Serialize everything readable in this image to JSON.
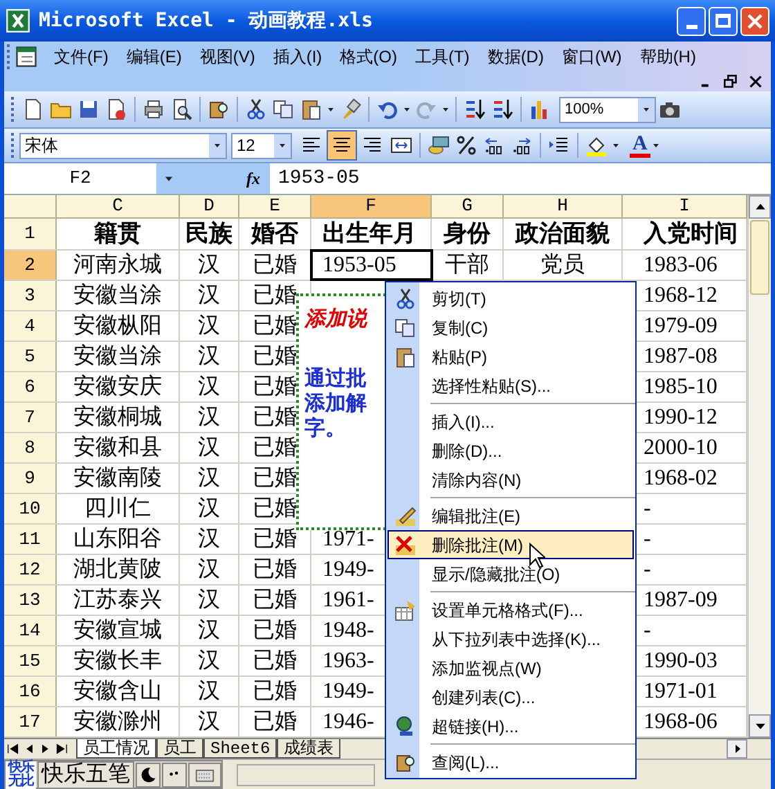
{
  "window": {
    "title": "Microsoft Excel - 动画教程.xls"
  },
  "menu_bar": [
    {
      "label": "文件(F)"
    },
    {
      "label": "编辑(E)"
    },
    {
      "label": "视图(V)"
    },
    {
      "label": "插入(I)"
    },
    {
      "label": "格式(O)"
    },
    {
      "label": "工具(T)"
    },
    {
      "label": "数据(D)"
    },
    {
      "label": "窗口(W)"
    },
    {
      "label": "帮助(H)"
    }
  ],
  "standard_toolbar": {
    "zoom": "100%"
  },
  "formatting_toolbar": {
    "font": "宋体",
    "size": "12",
    "align": [
      {
        "kind": "left",
        "selected": false
      },
      {
        "kind": "center",
        "selected": true
      },
      {
        "kind": "right",
        "selected": false
      }
    ],
    "font_color_label": "A"
  },
  "formula_bar": {
    "name_box": "F2",
    "function_label": "fx",
    "formula": "1953-05"
  },
  "sheet": {
    "columns": [
      {
        "label": "C",
        "selected": false
      },
      {
        "label": "D",
        "selected": false
      },
      {
        "label": "E",
        "selected": false
      },
      {
        "label": "F",
        "selected": true
      },
      {
        "label": "G",
        "selected": false
      },
      {
        "label": "H",
        "selected": false
      },
      {
        "label": "I",
        "selected": false
      }
    ],
    "rows": [
      {
        "header": "1",
        "selected": false,
        "cells": [
          "籍贯",
          "民族",
          "婚否",
          "出生年月",
          "身份",
          "政治面貌",
          "入党时间"
        ]
      },
      {
        "header": "2",
        "selected": true,
        "cells": [
          "河南永城",
          "汉",
          "已婚",
          "1953-05",
          "干部",
          "党员",
          "1983-06"
        ]
      },
      {
        "header": "3",
        "selected": false,
        "cells": [
          "安徽当涂",
          "汉",
          "已婚",
          null,
          null,
          null,
          "1968-12"
        ]
      },
      {
        "header": "4",
        "selected": false,
        "cells": [
          "安徽枞阳",
          "汉",
          "已婚",
          null,
          null,
          null,
          "1979-09"
        ]
      },
      {
        "header": "5",
        "selected": false,
        "cells": [
          "安徽当涂",
          "汉",
          "已婚",
          null,
          null,
          null,
          "1987-08"
        ]
      },
      {
        "header": "6",
        "selected": false,
        "cells": [
          "安徽安庆",
          "汉",
          "已婚",
          null,
          null,
          null,
          "1985-10"
        ]
      },
      {
        "header": "7",
        "selected": false,
        "cells": [
          "安徽桐城",
          "汉",
          "已婚",
          null,
          null,
          null,
          "1990-12"
        ]
      },
      {
        "header": "8",
        "selected": false,
        "cells": [
          "安徽和县",
          "汉",
          "已婚",
          null,
          null,
          null,
          "2000-10"
        ]
      },
      {
        "header": "9",
        "selected": false,
        "cells": [
          "安徽南陵",
          "汉",
          "已婚",
          null,
          null,
          null,
          "1968-02"
        ]
      },
      {
        "header": "10",
        "selected": false,
        "cells": [
          "四川仁",
          "汉",
          "已婚",
          null,
          null,
          null,
          "-"
        ]
      },
      {
        "header": "11",
        "selected": false,
        "cells": [
          "山东阳谷",
          "汉",
          "已婚",
          "1971-",
          null,
          null,
          "-"
        ]
      },
      {
        "header": "12",
        "selected": false,
        "cells": [
          "湖北黄陂",
          "汉",
          "已婚",
          "1949-",
          null,
          null,
          "-"
        ]
      },
      {
        "header": "13",
        "selected": false,
        "cells": [
          "江苏泰兴",
          "汉",
          "已婚",
          "1961-",
          null,
          null,
          "1987-09"
        ]
      },
      {
        "header": "14",
        "selected": false,
        "cells": [
          "安徽宣城",
          "汉",
          "已婚",
          "1948-",
          null,
          null,
          "-"
        ]
      },
      {
        "header": "15",
        "selected": false,
        "cells": [
          "安徽长丰",
          "汉",
          "已婚",
          "1963-",
          null,
          null,
          "1990-03"
        ]
      },
      {
        "header": "16",
        "selected": false,
        "cells": [
          "安徽含山",
          "汉",
          "已婚",
          "1949-",
          null,
          null,
          "1971-01"
        ]
      },
      {
        "header": "17",
        "selected": false,
        "cells": [
          "安徽滁州",
          "汉",
          "已婚",
          "1946-",
          null,
          null,
          "1968-06"
        ]
      }
    ]
  },
  "comment": {
    "title": "添加说",
    "lines": [
      "通过批",
      "添加解",
      "字。"
    ]
  },
  "context_menu": [
    [
      {
        "label": "剪切(T)",
        "selected": false
      },
      {
        "label": "复制(C)",
        "selected": false
      },
      {
        "label": "粘贴(P)",
        "selected": false
      },
      {
        "label": "选择性粘贴(S)...",
        "selected": false
      }
    ],
    [
      {
        "label": "插入(I)...",
        "selected": false
      },
      {
        "label": "删除(D)...",
        "selected": false
      },
      {
        "label": "清除内容(N)",
        "selected": false
      }
    ],
    [
      {
        "label": "编辑批注(E)",
        "selected": false
      },
      {
        "label": "删除批注(M)",
        "selected": true
      },
      {
        "label": "显示/隐藏批注(O)",
        "selected": false
      }
    ],
    [
      {
        "label": "设置单元格格式(F)...",
        "selected": false
      },
      {
        "label": "从下拉列表中选择(K)...",
        "selected": false
      },
      {
        "label": "添加监视点(W)",
        "selected": false
      },
      {
        "label": "创建列表(C)...",
        "selected": false
      },
      {
        "label": "超链接(H)...",
        "selected": false
      }
    ],
    [
      {
        "label": "查阅(L)...",
        "selected": false
      }
    ]
  ],
  "sheet_tabs": [
    {
      "label": "员工情况",
      "selected": true
    },
    {
      "label": "员工",
      "selected": false
    },
    {
      "label": "Sheet6",
      "selected": false
    },
    {
      "label": "成绩表",
      "selected": false
    }
  ],
  "ime_bar": {
    "logo": [
      "快乐",
      "无比"
    ],
    "name": "快乐五笔"
  }
}
